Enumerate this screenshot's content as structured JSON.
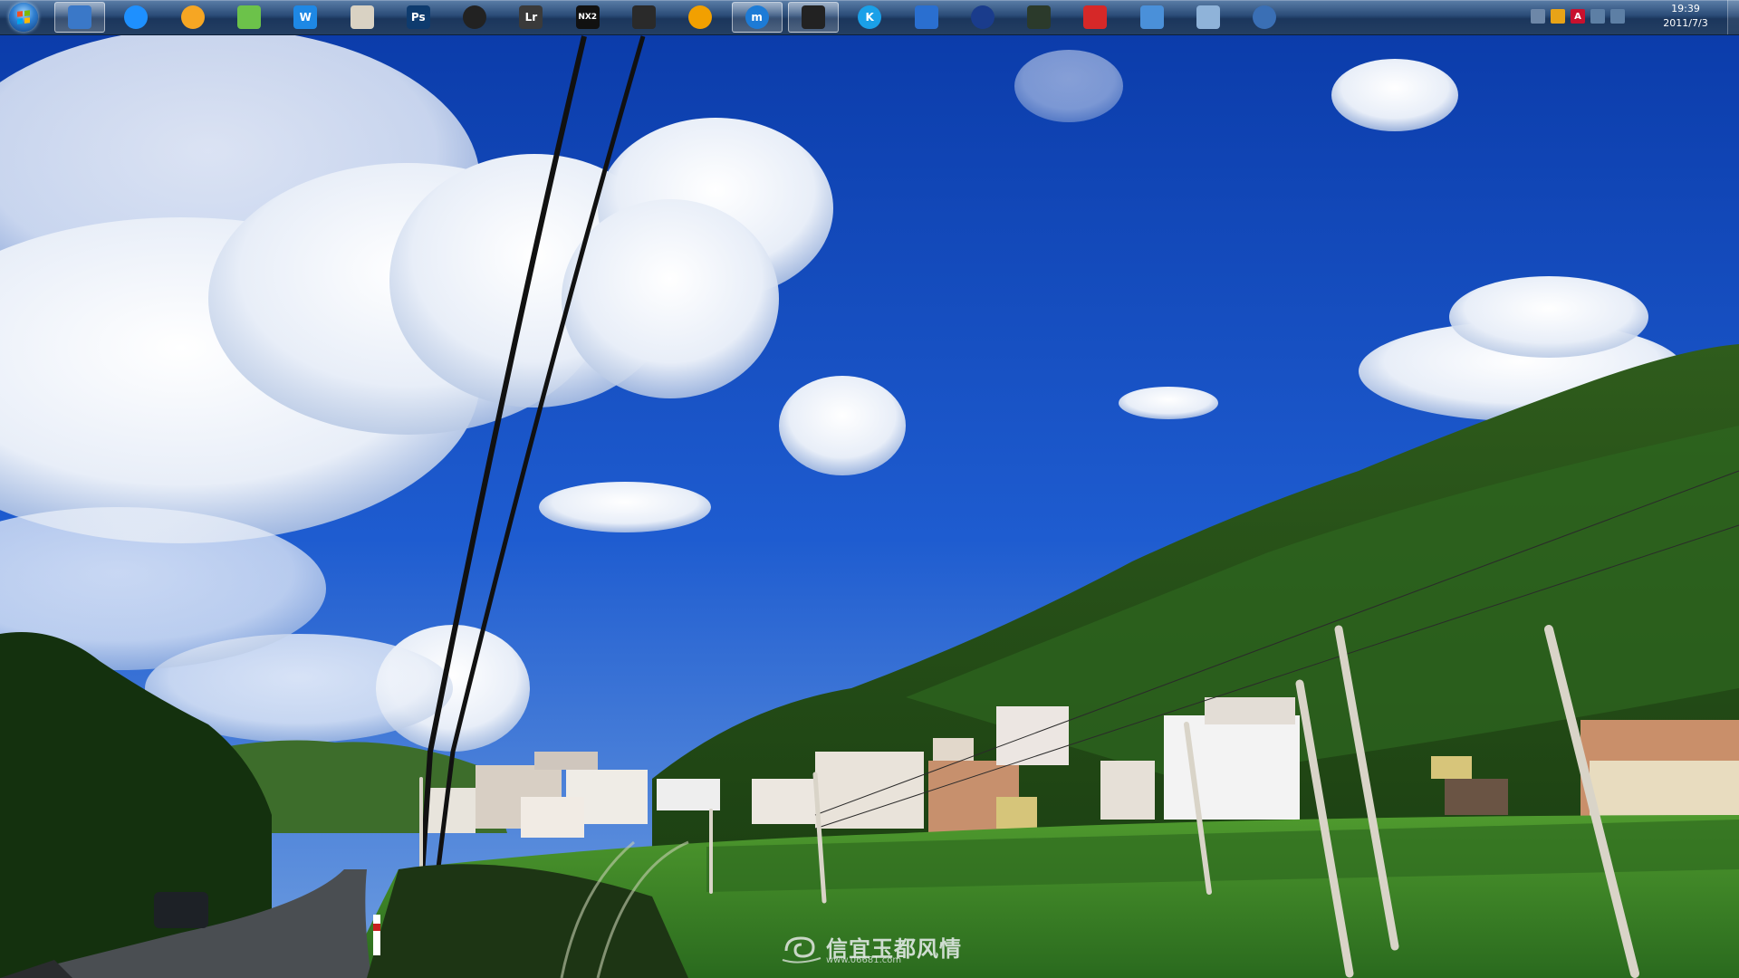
{
  "taskbar": {
    "start_button": "start-orb-icon",
    "pinned": [
      {
        "name": "computer-icon",
        "glyph": "",
        "bg": "#3a78c8",
        "active": true
      },
      {
        "name": "browser-icon",
        "glyph": "",
        "bg": "#1e90ff",
        "active": false
      },
      {
        "name": "chat-icon",
        "glyph": "",
        "bg": "#f6a623",
        "active": false
      },
      {
        "name": "android-tool-icon",
        "glyph": "",
        "bg": "#6cc24a",
        "active": false
      },
      {
        "name": "word-icon",
        "glyph": "W",
        "bg": "#1e88e5",
        "active": false
      },
      {
        "name": "image-viewer-icon",
        "glyph": "",
        "bg": "#d9d2c3",
        "active": false
      },
      {
        "name": "photoshop-icon",
        "glyph": "Ps",
        "bg": "#0e3b6e",
        "active": false
      },
      {
        "name": "media-player-icon",
        "glyph": "",
        "bg": "#222222",
        "active": false
      },
      {
        "name": "lightroom-icon",
        "glyph": "Lr",
        "bg": "#3a3a3a",
        "active": false
      },
      {
        "name": "nx2-icon",
        "glyph": "NX2",
        "bg": "#111111",
        "active": false
      },
      {
        "name": "fox-icon",
        "glyph": "",
        "bg": "#2a2a2a",
        "active": false
      },
      {
        "name": "music-player-icon",
        "glyph": "",
        "bg": "#f2a000",
        "active": false
      },
      {
        "name": "maxthon-icon",
        "glyph": "m",
        "bg": "#1d7bd6",
        "active": true
      },
      {
        "name": "qq-icon",
        "glyph": "",
        "bg": "#222222",
        "active": true
      },
      {
        "name": "kugou-icon",
        "glyph": "K",
        "bg": "#1aa0e8",
        "active": false
      },
      {
        "name": "bird-app-icon",
        "glyph": "",
        "bg": "#2a6fd0",
        "active": false
      },
      {
        "name": "google-earth-icon",
        "glyph": "",
        "bg": "#1a3c8c",
        "active": false
      },
      {
        "name": "game-icon",
        "glyph": "",
        "bg": "#2b3a2b",
        "active": false
      },
      {
        "name": "red-app-icon",
        "glyph": "",
        "bg": "#d62828",
        "active": false
      },
      {
        "name": "angry-bird-icon",
        "glyph": "",
        "bg": "#4a90d9",
        "active": false
      },
      {
        "name": "recycle-bin-icon",
        "glyph": "",
        "bg": "#8fb3d9",
        "active": false
      },
      {
        "name": "globe-icon",
        "glyph": "",
        "bg": "#3a6fb5",
        "active": false
      }
    ],
    "tray": {
      "icons": [
        {
          "name": "keyboard-icon",
          "glyph": "",
          "bg": "#6d87a8"
        },
        {
          "name": "qq-tray-icon",
          "glyph": "",
          "bg": "#e8a317"
        },
        {
          "name": "adobe-tray-icon",
          "glyph": "A",
          "bg": "#c8102e"
        },
        {
          "name": "network-icon",
          "glyph": "",
          "bg": "#5d7fa5"
        },
        {
          "name": "volume-icon",
          "glyph": "",
          "bg": "#5d7fa5"
        }
      ],
      "time": "19:39",
      "date": "2011/7/3"
    }
  },
  "watermark": {
    "title": "信宜玉都风情",
    "url": "www.06681.com"
  },
  "colors": {
    "sky_top": "#0b3fb4",
    "sky_bottom": "#3d78d6",
    "hill": "#1f4d18",
    "field": "#3c8a2c"
  }
}
